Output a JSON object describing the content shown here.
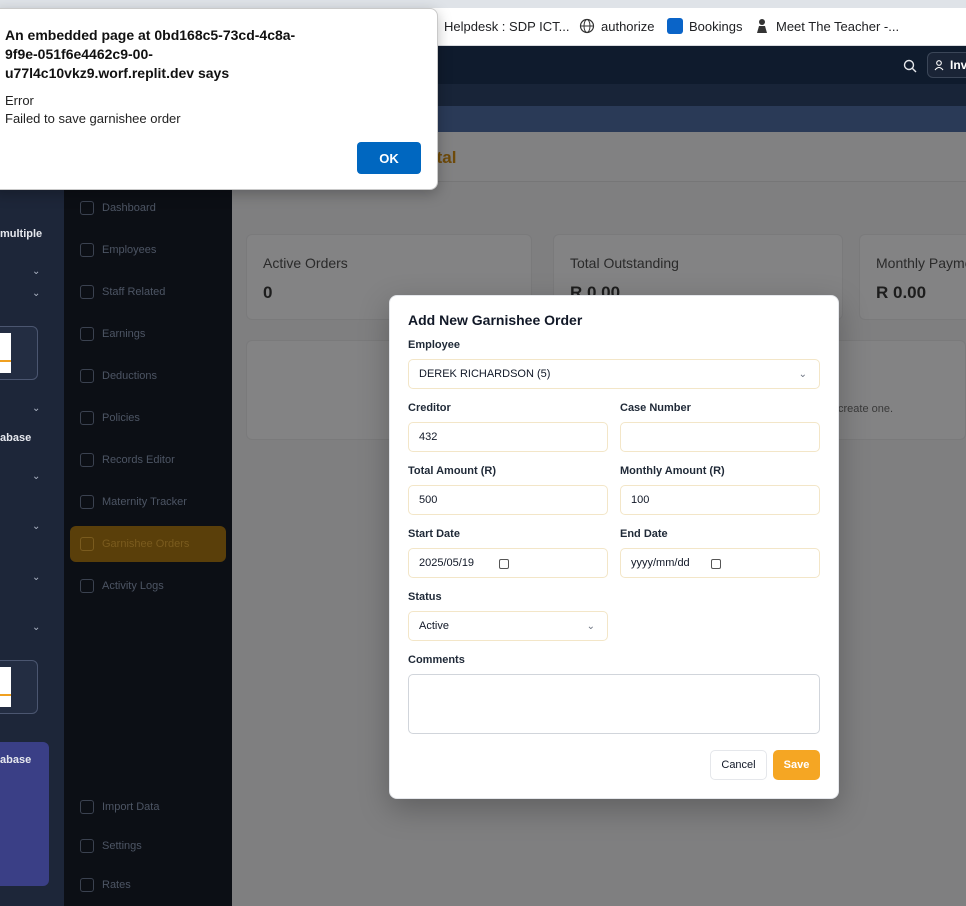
{
  "bookmarks": [
    {
      "label": "Helpdesk : SDP ICT...",
      "icon": "helpdesk-icon"
    },
    {
      "label": "authorize",
      "icon": "globe-icon"
    },
    {
      "label": "Bookings",
      "icon": "outlook-icon"
    },
    {
      "label": "Meet The Teacher -...",
      "icon": "person-icon"
    }
  ],
  "header": {
    "invite_label": "Invi"
  },
  "outer_sidebar": {
    "text1": "multiple",
    "text2": "abase",
    "text3": "abase"
  },
  "page": {
    "title": "rtal"
  },
  "nav": {
    "items": [
      {
        "label": "Dashboard"
      },
      {
        "label": "Employees"
      },
      {
        "label": "Staff Related"
      },
      {
        "label": "Earnings"
      },
      {
        "label": "Deductions"
      },
      {
        "label": "Policies"
      },
      {
        "label": "Records Editor"
      },
      {
        "label": "Maternity Tracker"
      },
      {
        "label": "Garnishee Orders"
      },
      {
        "label": "Activity Logs"
      }
    ],
    "bottom": [
      {
        "label": "Import Data"
      },
      {
        "label": "Settings"
      },
      {
        "label": "Rates"
      }
    ]
  },
  "cards": [
    {
      "label": "Active Orders",
      "value": "0"
    },
    {
      "label": "Total Outstanding",
      "value": "R 0.00"
    },
    {
      "label": "Monthly Payme",
      "value": "R 0.00"
    }
  ],
  "empty": {
    "text": "create one."
  },
  "modal": {
    "title": "Add New Garnishee Order",
    "employee_label": "Employee",
    "employee_value": "DEREK RICHARDSON (5)",
    "creditor_label": "Creditor",
    "creditor_value": "432",
    "case_label": "Case Number",
    "case_value": "",
    "total_label": "Total Amount (R)",
    "total_value": "500",
    "monthly_label": "Monthly Amount (R)",
    "monthly_value": "100",
    "start_label": "Start Date",
    "start_value": "2025/05/19",
    "end_label": "End Date",
    "end_value": "yyyy/mm/dd",
    "status_label": "Status",
    "status_value": "Active",
    "comments_label": "Comments",
    "cancel_label": "Cancel",
    "save_label": "Save"
  },
  "alert": {
    "title": "An embedded page at 0bd168c5-73cd-4c8a-9f9e-051f6e4462c9-00-u77l4c10vkz9.worf.replit.dev says",
    "line1": "Error",
    "line2": "Failed to save garnishee order",
    "ok_label": "OK"
  }
}
